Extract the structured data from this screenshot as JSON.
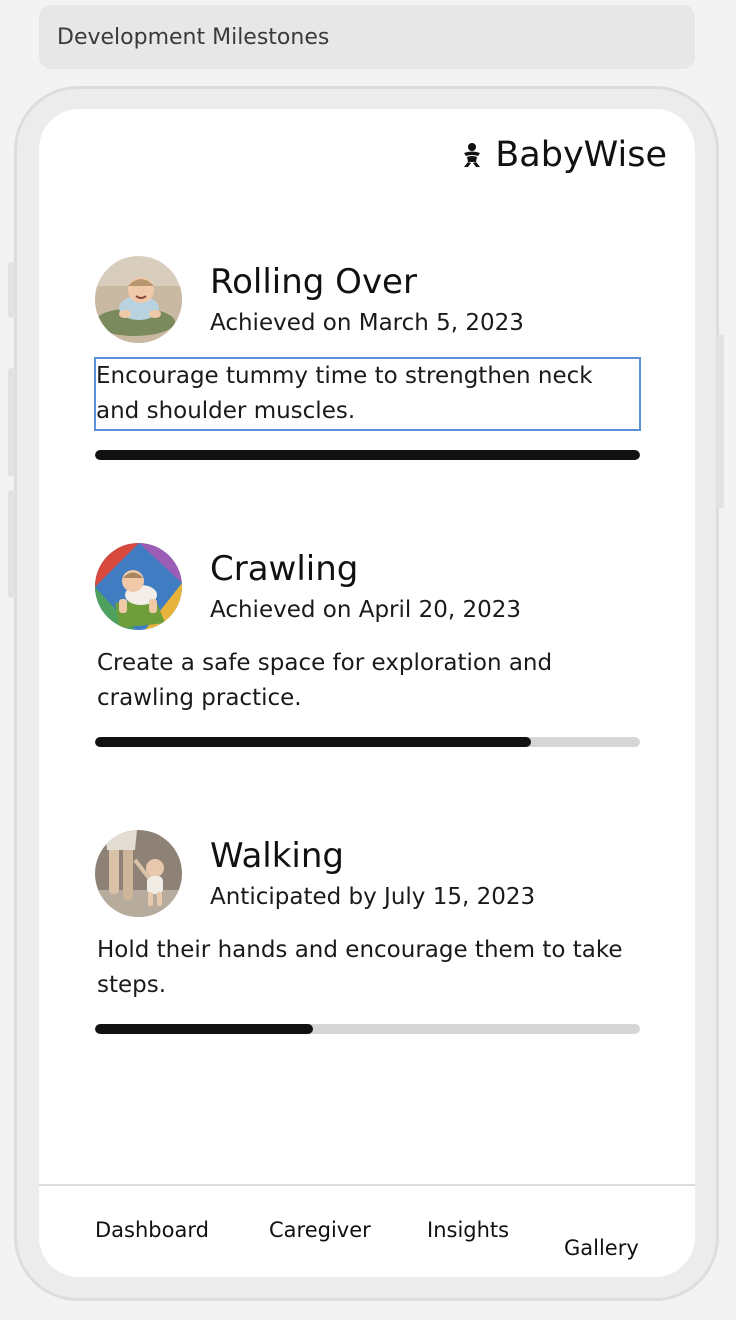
{
  "window": {
    "title": "Development Milestones"
  },
  "header": {
    "brand_name": "BabyWise",
    "brand_icon": "baby-icon"
  },
  "milestones": [
    {
      "title": "Rolling Over",
      "date": "Achieved on March 5, 2023",
      "tip": "Encourage tummy time to strengthen neck and shoulder muscles.",
      "progress": 1.0,
      "selected": true
    },
    {
      "title": "Crawling",
      "date": "Achieved on April 20, 2023",
      "tip": "Create a safe space for exploration and crawling practice.",
      "progress": 0.8,
      "selected": false
    },
    {
      "title": "Walking",
      "date": "Anticipated by July 15, 2023",
      "tip": "Hold their hands and encourage them to take steps.",
      "progress": 0.4,
      "selected": false
    }
  ],
  "nav": {
    "items": [
      "Dashboard",
      "Caregiver",
      "Insights",
      "Gallery"
    ]
  },
  "colors": {
    "progress_fill": "#111111",
    "progress_track": "#d6d6d6",
    "selection_outline": "#5b8fd6"
  }
}
